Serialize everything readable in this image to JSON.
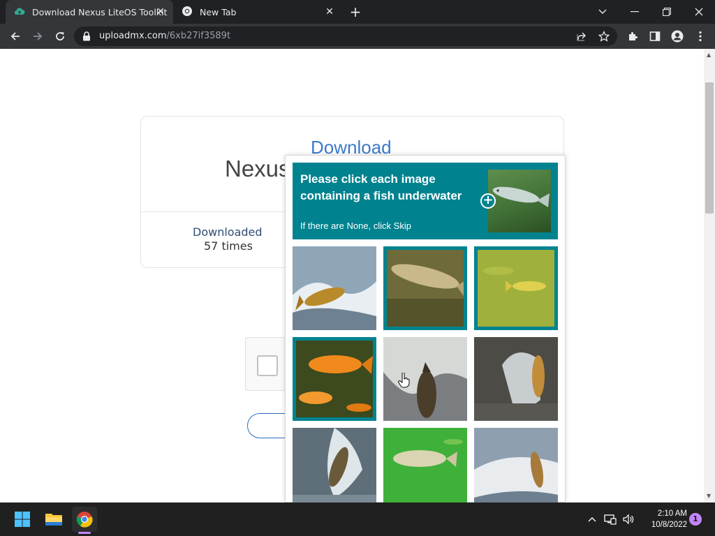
{
  "tabs": [
    {
      "title": "Download Nexus LiteOS Toolkit",
      "icon": "cloud-upload-icon",
      "close": "✕"
    },
    {
      "title": "New Tab",
      "icon": "chrome-icon",
      "close": "✕"
    }
  ],
  "new_tab": "+",
  "address": {
    "host": "uploadmx.com",
    "path": "/6xb27if3589t"
  },
  "page": {
    "title": "Nexus",
    "download_link": "Download",
    "downloaded_label": "Downloaded",
    "downloaded_count": "57 times"
  },
  "challenge": {
    "prompt": "Please click each image containing a fish underwater",
    "subprompt": "If there are None, click Skip",
    "plus": "+",
    "cells": [
      {
        "desc": "fish-jumping-splash",
        "selected": false
      },
      {
        "desc": "fish-underwater-murky",
        "selected": true
      },
      {
        "desc": "fish-underwater-green",
        "selected": true
      },
      {
        "desc": "goldfish-underwater",
        "selected": true
      },
      {
        "desc": "fish-jumping-waterfall",
        "selected": false
      },
      {
        "desc": "fish-leaping-rapids",
        "selected": false
      },
      {
        "desc": "fish-jumping-splash-2",
        "selected": false
      },
      {
        "desc": "fish-underwater-bright-green",
        "selected": false
      },
      {
        "desc": "fish-jumping-river",
        "selected": false
      }
    ]
  },
  "taskbar": {
    "time": "2:10 AM",
    "date": "10/8/2022",
    "notifications": "1"
  },
  "colors": {
    "accent": "#00838f",
    "link": "#3b7bc8",
    "chrome_dark": "#202124"
  }
}
